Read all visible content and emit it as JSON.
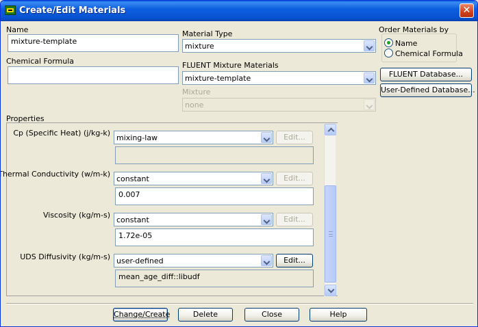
{
  "window": {
    "title": "Create/Edit Materials",
    "close_glyph": "✕"
  },
  "name": {
    "label": "Name",
    "value": "mixture-template"
  },
  "chemical_formula": {
    "label": "Chemical Formula",
    "value": ""
  },
  "material_type": {
    "label": "Material Type",
    "value": "mixture"
  },
  "fluent_mixture": {
    "label": "FLUENT Mixture Materials",
    "value": "mixture-template"
  },
  "mixture": {
    "label": "Mixture",
    "value": "none"
  },
  "order_by": {
    "label": "Order Materials by",
    "options": [
      {
        "label": "Name",
        "selected": true
      },
      {
        "label": "Chemical Formula",
        "selected": false
      }
    ]
  },
  "database_buttons": {
    "fluent": "FLUENT Database...",
    "user_defined": "User-Defined Database..."
  },
  "properties": {
    "label": "Properties",
    "edit_label": "Edit...",
    "items": [
      {
        "label": "Cp (Specific Heat) (j/kg-k)",
        "method": "mixing-law",
        "value": "",
        "edit_enabled": false
      },
      {
        "label": "Thermal Conductivity (w/m-k)",
        "method": "constant",
        "value": "0.007",
        "edit_enabled": false
      },
      {
        "label": "Viscosity (kg/m-s)",
        "method": "constant",
        "value": "1.72e-05",
        "edit_enabled": false
      },
      {
        "label": "UDS Diffusivity (kg/m-s)",
        "method": "user-defined",
        "value": "mean_age_diff::libudf",
        "edit_enabled": true
      }
    ]
  },
  "footer": {
    "change_create": "Change/Create",
    "delete": "Delete",
    "close": "Close",
    "help": "Help"
  }
}
